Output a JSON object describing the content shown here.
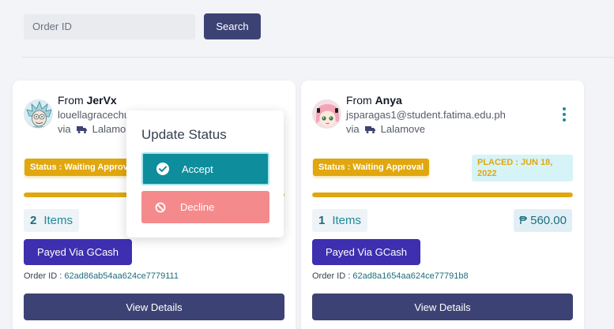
{
  "search": {
    "placeholder": "Order ID",
    "button_label": "Search"
  },
  "orders": [
    {
      "from_prefix": "From",
      "customer": "JerVx",
      "email": "louellagracechu",
      "via_prefix": "via",
      "courier": "Lalamo",
      "status": "Status : Waiting Approval",
      "items_count": "2",
      "items_label": "Items",
      "payment": "Payed Via GCash",
      "order_id_label": "Order ID :",
      "order_id": "62ad86ab54aa624ce7779111",
      "view_label": "View Details",
      "progress": 1.0
    },
    {
      "from_prefix": "From",
      "customer": "Anya",
      "email": "jsparagas1@student.fatima.edu.ph",
      "via_prefix": "via",
      "courier": "Lalamove",
      "status": "Status : Waiting Approval",
      "placed": "PLACED : JUN 18, 2022",
      "items_count": "1",
      "items_label": "Items",
      "price": "₱ 560.00",
      "payment": "Payed Via GCash",
      "order_id_label": "Order ID :",
      "order_id": "62ad8a1654aa624ce77791b8",
      "view_label": "View Details",
      "progress": 1.0
    }
  ],
  "status_menu": {
    "title": "Update Status",
    "accept_label": "Accept",
    "decline_label": "Decline"
  },
  "colors": {
    "primary": "#3c4374",
    "teal": "#0e8d9c",
    "waiting": "#e0a70e",
    "gcash": "#3e2fb0",
    "decline": "#f58a8c"
  },
  "icons": {
    "courier": "truck-icon",
    "menu": "kebab-menu-icon",
    "accept": "check-circle-icon",
    "decline": "ban-icon"
  }
}
